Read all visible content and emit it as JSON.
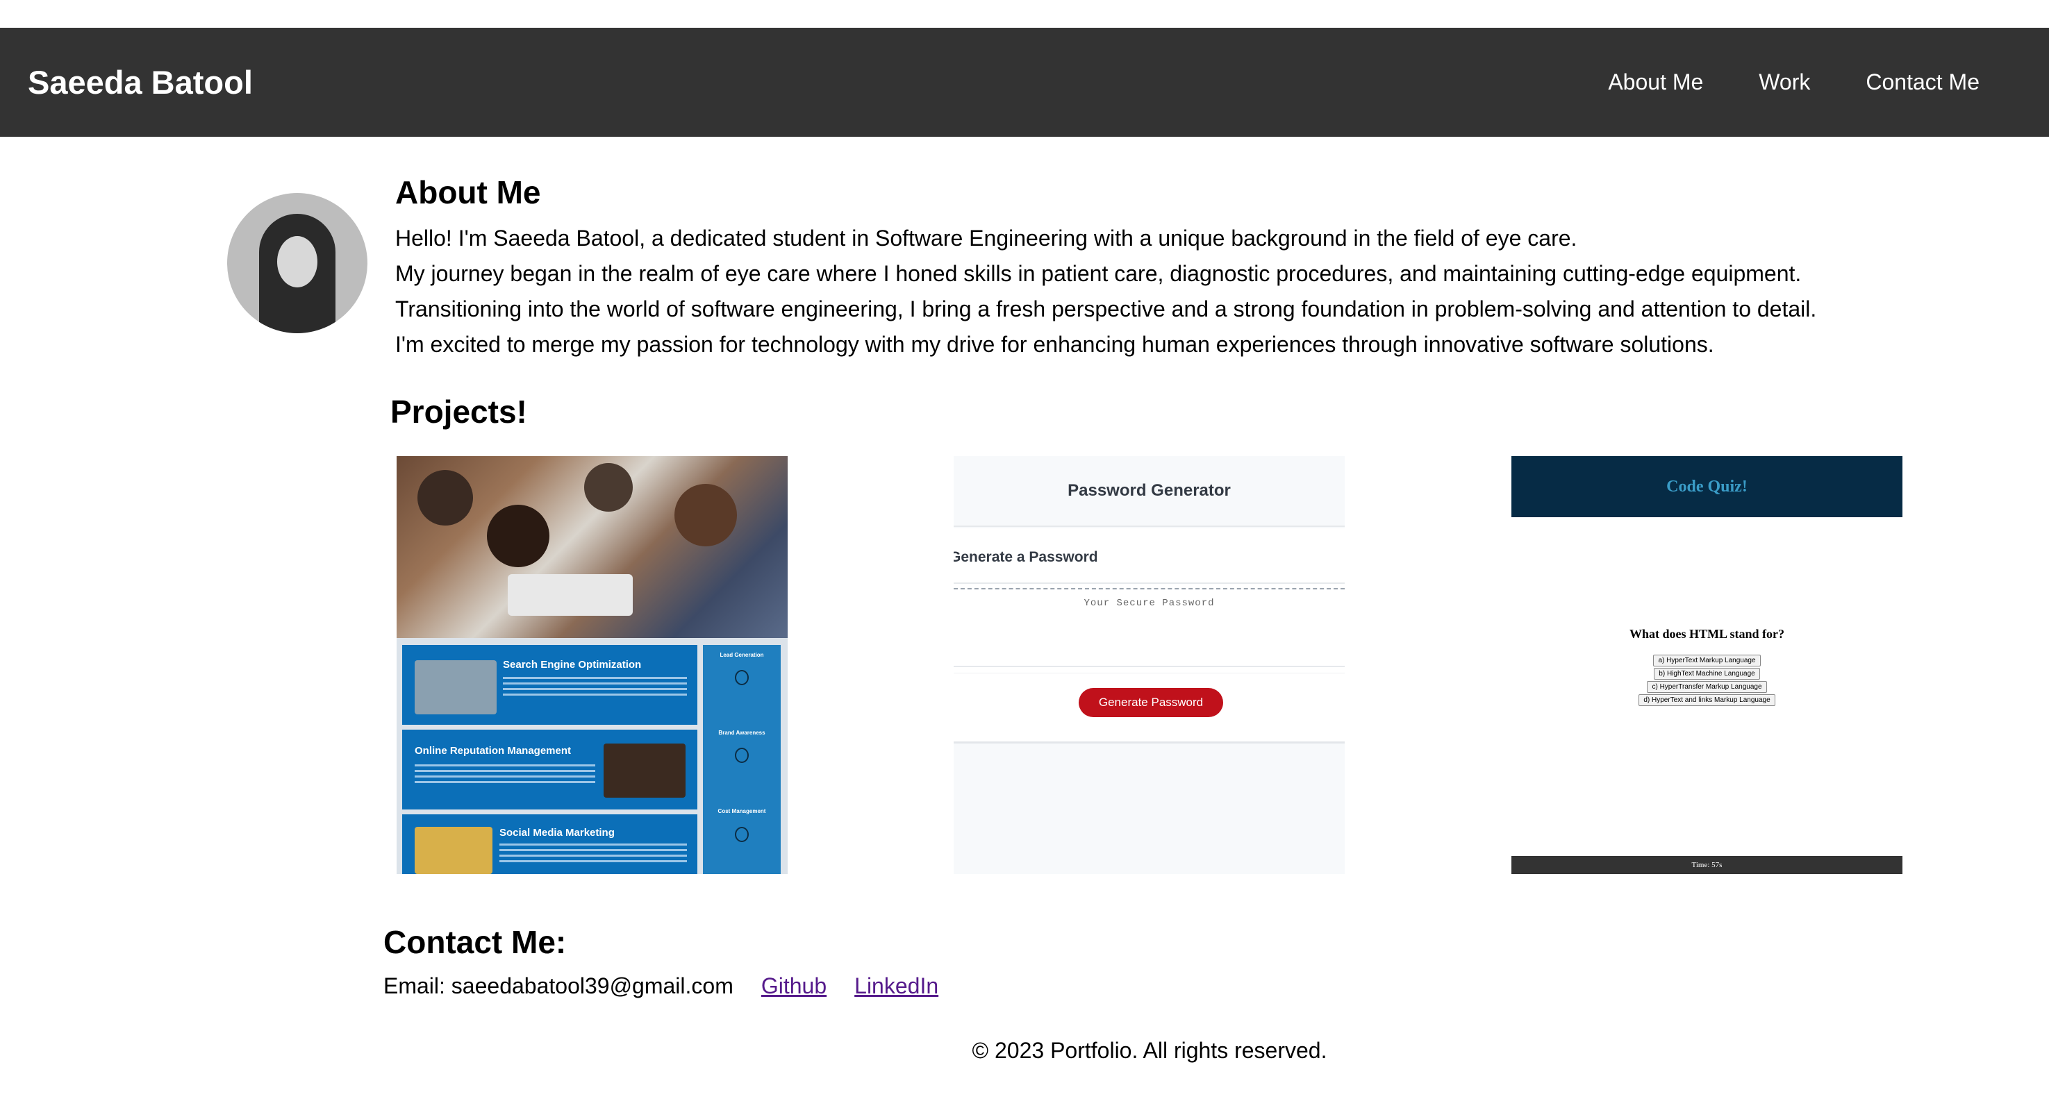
{
  "header": {
    "brand": "Saeeda Batool",
    "nav": [
      "About Me",
      "Work",
      "Contact Me"
    ]
  },
  "about": {
    "heading": "About Me",
    "paragraphs": [
      "Hello! I'm Saeeda Batool, a dedicated student in Software Engineering with a unique background in the field of eye care.",
      "My journey began in the realm of eye care where I honed skills in patient care, diagnostic procedures, and maintaining cutting-edge equipment.",
      "Transitioning into the world of software engineering, I bring a fresh perspective and a strong foundation in problem-solving and attention to detail.",
      "I'm excited to merge my passion for technology with my drive for enhancing human experiences through innovative software solutions."
    ]
  },
  "projects": {
    "heading": "Projects!",
    "project1": {
      "tiles": [
        "Search Engine Optimization",
        "Online Reputation Management",
        "Social Media Marketing"
      ],
      "side": [
        "Lead Generation",
        "Brand Awareness",
        "Cost Management"
      ]
    },
    "project2": {
      "title": "Password Generator",
      "subtitle": "Generate a Password",
      "placeholder": "Your Secure Password",
      "button": "Generate Password"
    },
    "project3": {
      "title": "Code Quiz!",
      "question": "What does HTML stand for?",
      "options": [
        "a) HyperText Markup Language",
        "b) HighText Machine Language",
        "c) HyperTransfer Markup Language",
        "d) HyperText and links Markup Language"
      ],
      "timer": "Time: 57s"
    }
  },
  "contact": {
    "heading": "Contact Me:",
    "email": "Email: saeedabatool39@gmail.com",
    "github": "Github",
    "linkedin": "LinkedIn"
  },
  "footer": {
    "text": "© 2023 Portfolio. All rights reserved."
  },
  "colors": {
    "header_bg": "#333333",
    "link_visited": "#551a8b",
    "quiz_header": "#062b45",
    "generate_button": "#c0111b"
  }
}
